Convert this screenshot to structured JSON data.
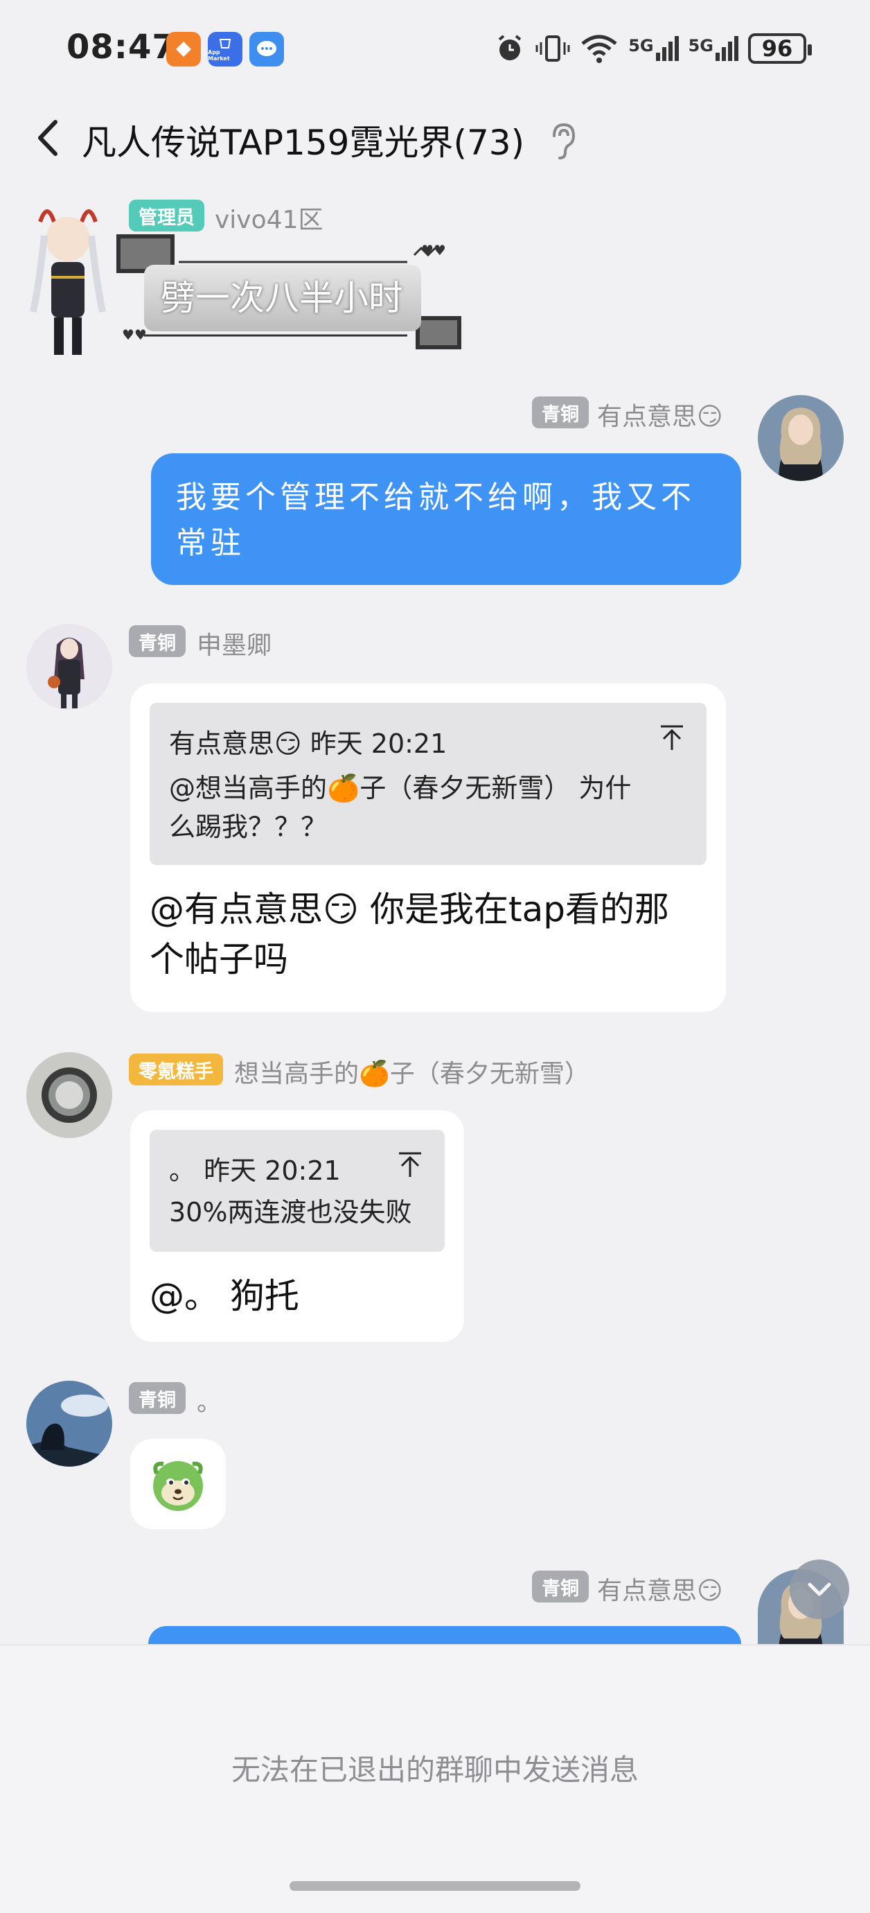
{
  "status_bar": {
    "time": "08:47",
    "battery": "96",
    "network_labels": [
      "5G",
      "5G"
    ],
    "app_badge_label": "App Market"
  },
  "header": {
    "title": "凡人传说TAP159霓光界(73)"
  },
  "messages": [
    {
      "side": "left",
      "badge": "管理员",
      "badge_color": "#54cbb9",
      "nick": "vivo41区",
      "text": "劈一次八半小时"
    },
    {
      "side": "right",
      "badge": "青铜",
      "badge_color": "#a9abb0",
      "nick": "有点意思😏",
      "text_line1": "我要个管理不给就不给啊，我又不",
      "text_line2": "常驻"
    },
    {
      "side": "left",
      "badge": "青铜",
      "badge_color": "#a9abb0",
      "nick": "申墨卿",
      "quote_head": "有点意思😏 昨天 20:21",
      "quote_line1": "@想当高手的🍊子（春夕无新雪） 为什",
      "quote_line2": "么踢我？？？",
      "text_line1": "@有点意思😏 你是我在tap看的那",
      "text_line2": "个帖子吗"
    },
    {
      "side": "left",
      "badge": "零氪糕手",
      "badge_color": "#f3b73d",
      "nick": "想当高手的🍊子（春夕无新雪）",
      "quote_head": "。 昨天 20:21",
      "quote_line1": "30%两连渡也没失败",
      "text": "@。 狗托"
    },
    {
      "side": "left",
      "badge": "青铜",
      "badge_color": "#a9abb0",
      "nick": "。",
      "sticker": "cabbage-dog-sticker"
    },
    {
      "side": "right",
      "badge": "青铜",
      "badge_color": "#a9abb0",
      "nick": "有点意思😏"
    }
  ],
  "bottom": {
    "notice": "无法在已退出的群聊中发送消息"
  },
  "colors": {
    "accent_blue": "#3f93f4",
    "background": "#f1f1f3"
  }
}
